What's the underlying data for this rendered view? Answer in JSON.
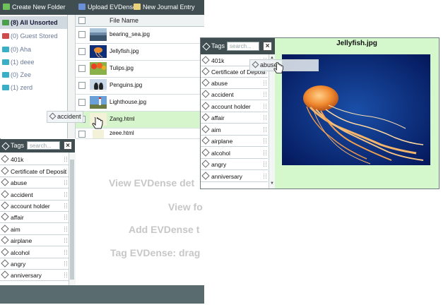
{
  "toolbar": {
    "create_folder": "Create New Folder",
    "upload": "Upload EVDense",
    "new_journal": "New Journal Entry"
  },
  "folders": [
    {
      "label": "(8) All Unsorted",
      "color": "#4aa04a"
    },
    {
      "label": "(0) Guest Stored",
      "color": "#d04a4a"
    },
    {
      "label": "(0) Aha",
      "color": "#3ab0c8"
    },
    {
      "label": "(1) deee",
      "color": "#3ab0c8"
    },
    {
      "label": "(0) Zee",
      "color": "#3ab0c8"
    },
    {
      "label": "(1) zerd",
      "color": "#3ab0c8"
    }
  ],
  "filelist": {
    "header": "File Name",
    "files": [
      {
        "name": "bearing_sea.jpg"
      },
      {
        "name": "Jellyfish.jpg"
      },
      {
        "name": "Tulips.jpg"
      },
      {
        "name": "Penguins.jpg"
      },
      {
        "name": "Lighthouse.jpg"
      },
      {
        "name": "Zang.html"
      },
      {
        "name": "zeee.html"
      }
    ]
  },
  "drag_tag_main": "accident",
  "drag_tag_popup": "abuse",
  "tags_panel": {
    "title": "Tags",
    "search_placeholder": "search...",
    "close": "×",
    "items": [
      "401k",
      "Certificate of Deposit",
      "abuse",
      "accident",
      "account holder",
      "affair",
      "aim",
      "airplane",
      "alcohol",
      "angry",
      "anniversary"
    ]
  },
  "popup_tags_panel": {
    "title": "Tags",
    "search_placeholder": "search...",
    "close": "×",
    "items": [
      "401k",
      "Certificate of Deposi",
      "abuse",
      "accident",
      "account holder",
      "affair",
      "aim",
      "airplane",
      "alcohol",
      "angry",
      "anniversary"
    ]
  },
  "preview": {
    "title": "Jellyfish.jpg"
  },
  "overlay_lines": [
    "View EVDense det",
    "View fo",
    "Add EVDense t",
    "Tag EVDense: drag"
  ],
  "colors": {
    "toolbar_bg": "#404e52",
    "selected_row": "#d6f5cc",
    "preview_bg": "#d4f7cc"
  }
}
